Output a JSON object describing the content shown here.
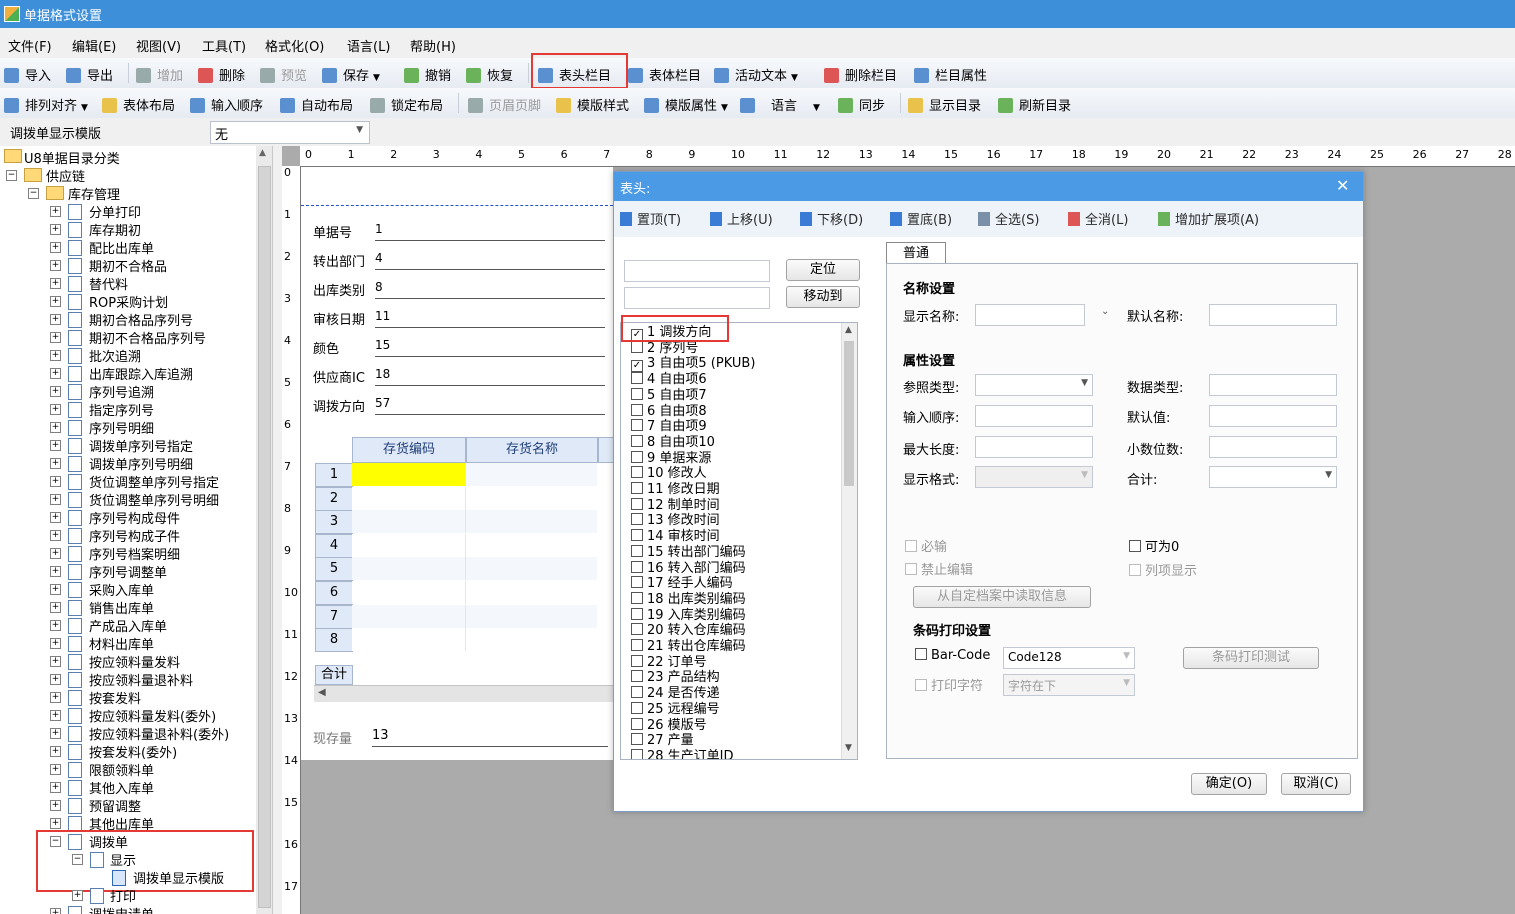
{
  "window": {
    "title": "单据格式设置"
  },
  "menu": [
    "文件(F)",
    "编辑(E)",
    "视图(V)",
    "工具(T)",
    "格式化(O)",
    "语言(L)",
    "帮助(H)"
  ],
  "toolbar1": {
    "import": "导入",
    "export": "导出",
    "add": "增加",
    "delete": "删除",
    "preview": "预览",
    "save": "保存",
    "undo": "撤销",
    "redo": "恢复",
    "header_columns": "表头栏目",
    "body_columns": "表体栏目",
    "active_text": "活动文本",
    "delete_column": "删除栏目",
    "column_props": "栏目属性"
  },
  "toolbar2": {
    "align": "排列对齐",
    "body_layout": "表体布局",
    "input_order": "输入顺序",
    "auto_layout": "自动布局",
    "lock_layout": "锁定布局",
    "header_footer": "页眉页脚",
    "template_style": "模版样式",
    "template_props": "模版属性",
    "language": "语言",
    "sync": "同步",
    "show_catalog": "显示目录",
    "refresh_catalog": "刷新目录"
  },
  "template_selector": {
    "label": "调拨单显示模版",
    "value": "无"
  },
  "tree": {
    "root": "U8单据目录分类",
    "supply_chain": "供应链",
    "inventory": "库存管理",
    "items": [
      "分单打印",
      "库存期初",
      "配比出库单",
      "期初不合格品",
      "替代料",
      "ROP采购计划",
      "期初合格品序列号",
      "期初不合格品序列号",
      "批次追溯",
      "出库跟踪入库追溯",
      "序列号追溯",
      "指定序列号",
      "序列号明细",
      "调拨单序列号指定",
      "调拨单序列号明细",
      "货位调整单序列号指定",
      "货位调整单序列号明细",
      "序列号构成母件",
      "序列号构成子件",
      "序列号档案明细",
      "序列号调整单",
      "采购入库单",
      "销售出库单",
      "产成品入库单",
      "材料出库单",
      "按应领料量发料",
      "按应领料量退补料",
      "按套发料",
      "按应领料量发料(委外)",
      "按应领料量退补料(委外)",
      "按套发料(委外)",
      "限额领料单",
      "其他入库单",
      "预留调整",
      "其他出库单"
    ],
    "transfer": "调拨单",
    "display": "显示",
    "display_template": "调拨单显示模版",
    "print": "打印",
    "transfer_request": "调拨申请单"
  },
  "ruler_h": [
    "0",
    "1",
    "2",
    "3",
    "4",
    "5",
    "6",
    "7",
    "8",
    "9",
    "10",
    "11",
    "12",
    "13",
    "14",
    "15",
    "16",
    "17",
    "18",
    "19",
    "20",
    "21",
    "22",
    "23",
    "24",
    "25",
    "26",
    "27",
    "28"
  ],
  "ruler_v": [
    "0",
    "1",
    "2",
    "3",
    "4",
    "5",
    "6",
    "7",
    "8",
    "9",
    "10",
    "11",
    "12",
    "13",
    "14",
    "15",
    "16",
    "17"
  ],
  "canvas": {
    "fields": [
      {
        "label": "单据号",
        "value": "1"
      },
      {
        "label": "转出部门",
        "value": "4"
      },
      {
        "label": "出库类别",
        "value": "8"
      },
      {
        "label": "审核日期",
        "value": "11"
      },
      {
        "label": "颜色",
        "value": "15"
      },
      {
        "label": "供应商IC",
        "value": "18"
      },
      {
        "label": "调拨方向",
        "value": "57"
      }
    ],
    "grid_headers": [
      "存货编码",
      "存货名称"
    ],
    "grid_rows": [
      "1",
      "2",
      "3",
      "4",
      "5",
      "6",
      "7",
      "8"
    ],
    "total_label": "合计",
    "stock_label": "现存量",
    "stock_value": "13"
  },
  "dialog": {
    "title": "表头:",
    "toolbar": [
      "置顶(T)",
      "上移(U)",
      "下移(D)",
      "置底(B)",
      "全选(S)",
      "全消(L)",
      "增加扩展项(A)"
    ],
    "locate": "定位",
    "move_to": "移动到",
    "items": [
      {
        "text": "1  调拨方向",
        "checked": true
      },
      {
        "text": "2  序列号",
        "checked": false
      },
      {
        "text": "3  自由项5 (PKUB)",
        "checked": true
      },
      {
        "text": "4  自由项6",
        "checked": false
      },
      {
        "text": "5  自由项7",
        "checked": false
      },
      {
        "text": "6  自由项8",
        "checked": false
      },
      {
        "text": "7  自由项9",
        "checked": false
      },
      {
        "text": "8  自由项10",
        "checked": false
      },
      {
        "text": "9  单据来源",
        "checked": false
      },
      {
        "text": "10  修改人",
        "checked": false
      },
      {
        "text": "11  修改日期",
        "checked": false
      },
      {
        "text": "12  制单时间",
        "checked": false
      },
      {
        "text": "13  修改时间",
        "checked": false
      },
      {
        "text": "14  审核时间",
        "checked": false
      },
      {
        "text": "15  转出部门编码",
        "checked": false
      },
      {
        "text": "16  转入部门编码",
        "checked": false
      },
      {
        "text": "17  经手人编码",
        "checked": false
      },
      {
        "text": "18  出库类别编码",
        "checked": false
      },
      {
        "text": "19  入库类别编码",
        "checked": false
      },
      {
        "text": "20  转入仓库编码",
        "checked": false
      },
      {
        "text": "21  转出仓库编码",
        "checked": false
      },
      {
        "text": "22  订单号",
        "checked": false
      },
      {
        "text": "23  产品结构",
        "checked": false
      },
      {
        "text": "24  是否传递",
        "checked": false
      },
      {
        "text": "25  远程编号",
        "checked": false
      },
      {
        "text": "26  模版号",
        "checked": false
      },
      {
        "text": "27  产量",
        "checked": false
      },
      {
        "text": "28  生产订单ID",
        "checked": false
      }
    ],
    "tab": "普通",
    "name_section": "名称设置",
    "display_name": "显示名称:",
    "default_name": "默认名称:",
    "attr_section": "属性设置",
    "ref_type": "参照类型:",
    "data_type": "数据类型:",
    "input_order": "输入顺序:",
    "default_value": "默认值:",
    "max_length": "最大长度:",
    "decimals": "小数位数:",
    "display_format": "显示格式:",
    "total": "合计:",
    "required": "必输",
    "allow_zero": "可为0",
    "no_edit": "禁止编辑",
    "list_display": "列项显示",
    "read_archive": "从自定档案中读取信息",
    "barcode_section": "条码打印设置",
    "barcode": "Bar-Code",
    "barcode_type": "Code128",
    "print_chars": "打印字符",
    "chars_pos": "字符在下",
    "barcode_test": "条码打印测试",
    "ok": "确定(O)",
    "cancel": "取消(C)"
  }
}
